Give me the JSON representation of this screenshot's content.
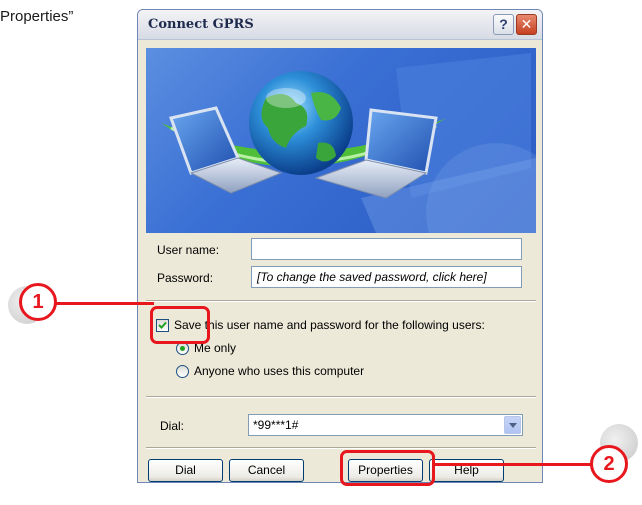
{
  "caption": "Properties”",
  "window": {
    "title": "Connect GPRS",
    "help_glyph": "?",
    "close_glyph": "✕"
  },
  "form": {
    "username_label": "User name:",
    "username_value": "",
    "password_label": "Password:",
    "password_value": "[To change the saved password, click here]",
    "save_label": "Save this user name and password for the following users:",
    "save_checked": true,
    "radio_me_label": "Me only",
    "radio_anyone_label": "Anyone who uses this computer",
    "selected_radio": "me_only",
    "dial_label": "Dial:",
    "dial_value": "*99***1#"
  },
  "buttons": {
    "dial": "Dial",
    "cancel": "Cancel",
    "properties": "Properties",
    "help": "Help"
  },
  "callouts": {
    "one": "1",
    "two": "2",
    "color": "#e8171e"
  }
}
